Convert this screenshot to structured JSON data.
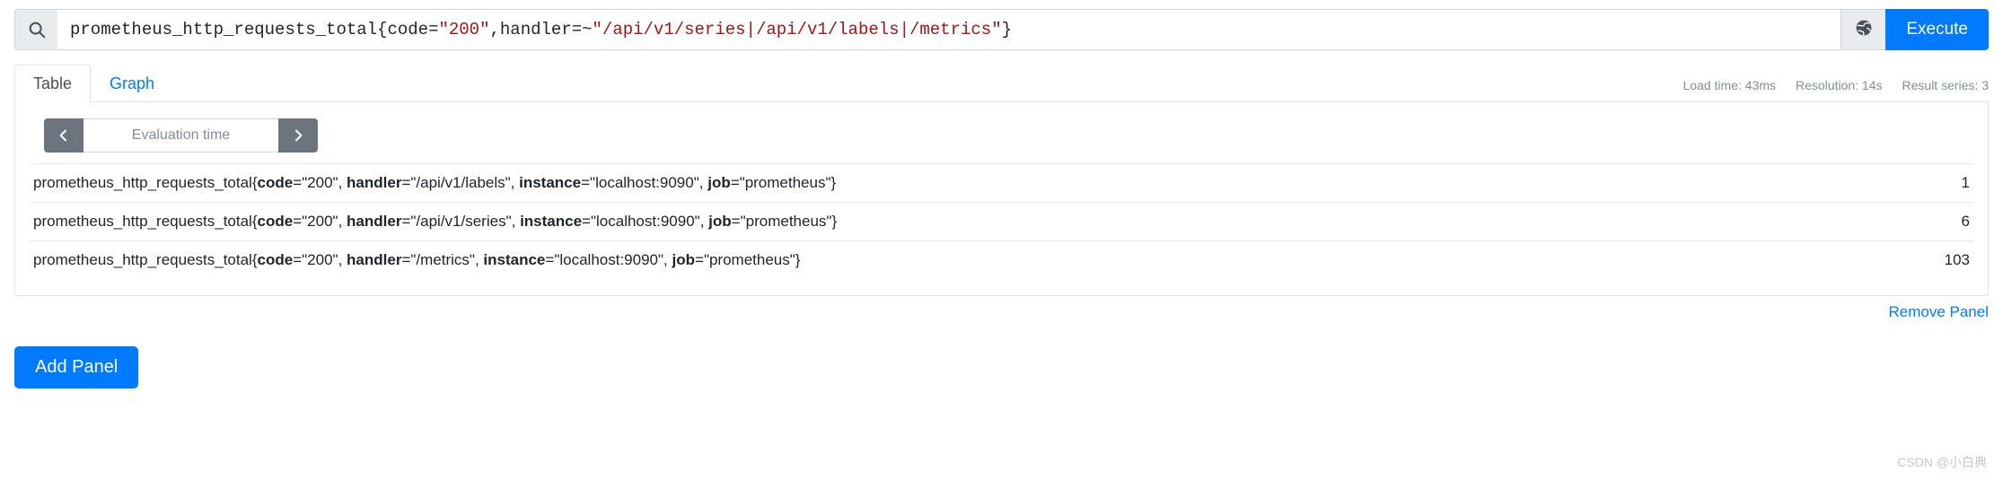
{
  "query_bar": {
    "search_icon": "search-icon",
    "query_prefix": "prometheus_http_requests_total{code=",
    "query_code_value": "\"200\"",
    "query_mid": ",handler=~",
    "query_handler_value": "\"/api/v1/series|/api/v1/labels|/metrics\"",
    "query_suffix": "}",
    "query_full": "prometheus_http_requests_total{code=\"200\",handler=~\"/api/v1/series|/api/v1/labels|/metrics\"}",
    "globe_icon": "globe-icon",
    "execute_label": "Execute",
    "accent_color": "#007bff"
  },
  "tabs": [
    {
      "label": "Table",
      "active": true
    },
    {
      "label": "Graph",
      "active": false
    }
  ],
  "meta": {
    "load_time": "Load time: 43ms",
    "resolution": "Resolution: 14s",
    "result_series": "Result series: 3"
  },
  "evaluation_time": {
    "prev_icon": "chevron-left-icon",
    "next_icon": "chevron-right-icon",
    "placeholder": "Evaluation time",
    "value": ""
  },
  "results": {
    "rows": [
      {
        "metric": "prometheus_http_requests_total{",
        "labels": [
          {
            "name": "code",
            "value": "\"200\""
          },
          {
            "name": "handler",
            "value": "\"/api/v1/labels\""
          },
          {
            "name": "instance",
            "value": "\"localhost:9090\""
          },
          {
            "name": "job",
            "value": "\"prometheus\""
          }
        ],
        "close": "}",
        "value": "1"
      },
      {
        "metric": "prometheus_http_requests_total{",
        "labels": [
          {
            "name": "code",
            "value": "\"200\""
          },
          {
            "name": "handler",
            "value": "\"/api/v1/series\""
          },
          {
            "name": "instance",
            "value": "\"localhost:9090\""
          },
          {
            "name": "job",
            "value": "\"prometheus\""
          }
        ],
        "close": "}",
        "value": "6"
      },
      {
        "metric": "prometheus_http_requests_total{",
        "labels": [
          {
            "name": "code",
            "value": "\"200\""
          },
          {
            "name": "handler",
            "value": "\"/metrics\""
          },
          {
            "name": "instance",
            "value": "\"localhost:9090\""
          },
          {
            "name": "job",
            "value": "\"prometheus\""
          }
        ],
        "close": "}",
        "value": "103"
      }
    ]
  },
  "footer": {
    "remove_panel_label": "Remove Panel",
    "add_panel_label": "Add Panel"
  },
  "watermark": "CSDN @小白典"
}
